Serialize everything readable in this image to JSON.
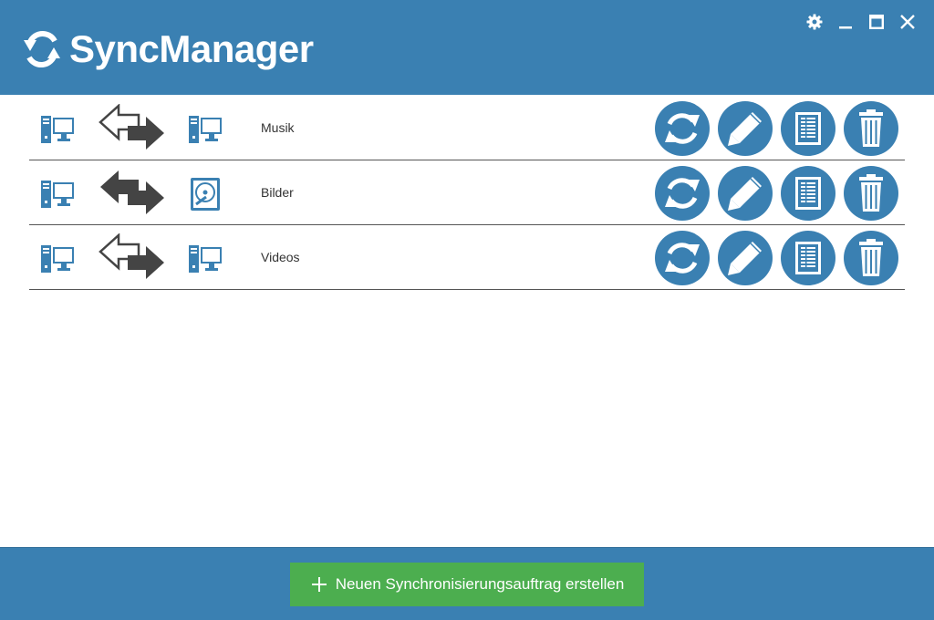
{
  "app": {
    "title": "SyncManager",
    "colors": {
      "brand": "#3a80b2",
      "create": "#4cae4f",
      "arrow_dark": "#444444"
    }
  },
  "window_controls": {
    "icons": [
      "gear-icon",
      "minimize-icon",
      "maximize-icon",
      "close-icon"
    ]
  },
  "jobs": [
    {
      "name": "Musik",
      "source_icon": "computer-icon",
      "target_icon": "computer-icon",
      "direction": "one-way"
    },
    {
      "name": "Bilder",
      "source_icon": "computer-icon",
      "target_icon": "hard-drive-icon",
      "direction": "two-way"
    },
    {
      "name": "Videos",
      "source_icon": "computer-icon",
      "target_icon": "computer-icon",
      "direction": "one-way"
    }
  ],
  "row_actions": [
    "sync-icon",
    "edit-icon",
    "log-icon",
    "delete-icon"
  ],
  "footer": {
    "create_label": "Neuen Synchronisierungsauftrag erstellen"
  }
}
